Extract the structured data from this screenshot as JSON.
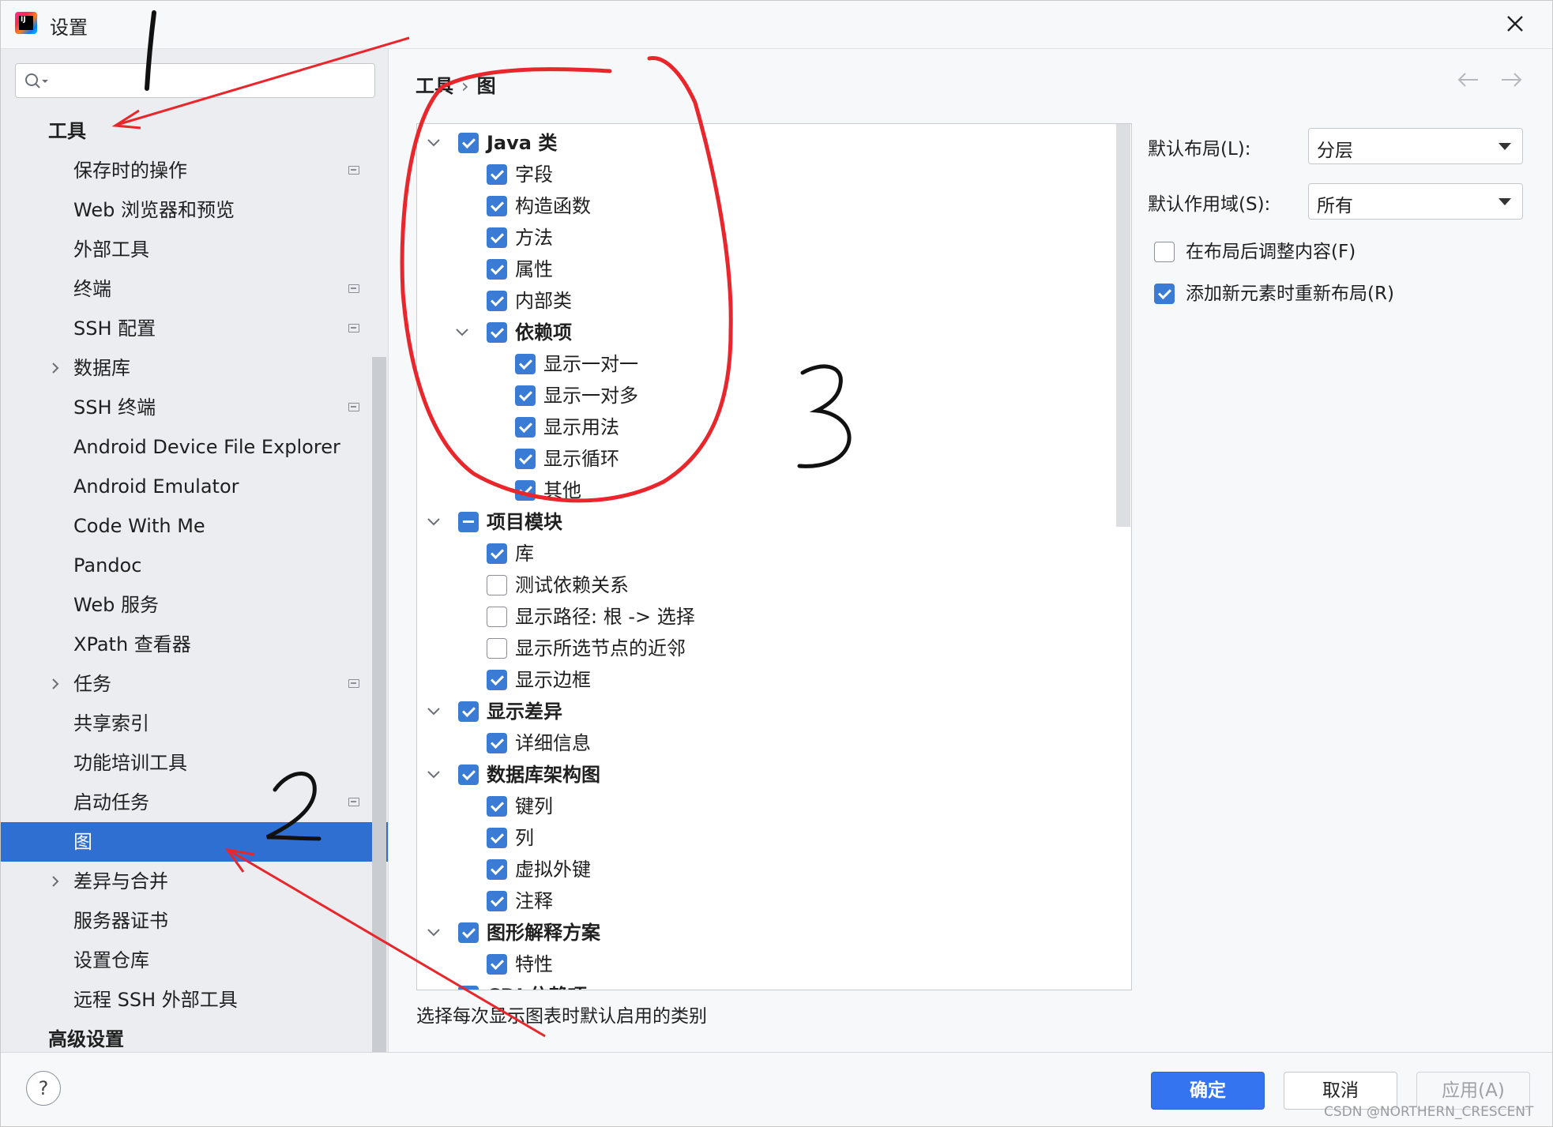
{
  "window": {
    "title": "设置"
  },
  "search": {
    "placeholder": "",
    "value": ""
  },
  "sidebar": {
    "items": [
      {
        "label": "工具",
        "group": true
      },
      {
        "label": "保存时的操作",
        "project": true
      },
      {
        "label": "Web 浏览器和预览"
      },
      {
        "label": "外部工具"
      },
      {
        "label": "终端",
        "project": true
      },
      {
        "label": "SSH 配置",
        "project": true
      },
      {
        "label": "数据库",
        "expandable": true
      },
      {
        "label": "SSH 终端",
        "project": true
      },
      {
        "label": "Android Device File Explorer"
      },
      {
        "label": "Android Emulator"
      },
      {
        "label": "Code With Me"
      },
      {
        "label": "Pandoc"
      },
      {
        "label": "Web 服务"
      },
      {
        "label": "XPath 查看器"
      },
      {
        "label": "任务",
        "expandable": true,
        "project": true
      },
      {
        "label": "共享索引"
      },
      {
        "label": "功能培训工具"
      },
      {
        "label": "启动任务",
        "project": true
      },
      {
        "label": "图",
        "selected": true
      },
      {
        "label": "差异与合并",
        "expandable": true
      },
      {
        "label": "服务器证书"
      },
      {
        "label": "设置仓库"
      },
      {
        "label": "远程 SSH 外部工具"
      },
      {
        "label": "高级设置",
        "group": true
      }
    ]
  },
  "breadcrumb": {
    "parent": "工具",
    "separator": "›",
    "current": "图"
  },
  "categories": [
    {
      "label": "Java 类",
      "level": 0,
      "state": "checked",
      "group": true,
      "expanded": true
    },
    {
      "label": "字段",
      "level": 1,
      "state": "checked"
    },
    {
      "label": "构造函数",
      "level": 1,
      "state": "checked"
    },
    {
      "label": "方法",
      "level": 1,
      "state": "checked"
    },
    {
      "label": "属性",
      "level": 1,
      "state": "checked"
    },
    {
      "label": "内部类",
      "level": 1,
      "state": "checked"
    },
    {
      "label": "依赖项",
      "level": 1,
      "state": "checked",
      "group": true,
      "expanded": true
    },
    {
      "label": "显示一对一",
      "level": 2,
      "state": "checked"
    },
    {
      "label": "显示一对多",
      "level": 2,
      "state": "checked"
    },
    {
      "label": "显示用法",
      "level": 2,
      "state": "checked"
    },
    {
      "label": "显示循环",
      "level": 2,
      "state": "checked"
    },
    {
      "label": "其他",
      "level": 2,
      "state": "checked"
    },
    {
      "label": "项目模块",
      "level": 0,
      "state": "partial",
      "group": true,
      "expanded": true
    },
    {
      "label": "库",
      "level": 1,
      "state": "checked"
    },
    {
      "label": "测试依赖关系",
      "level": 1,
      "state": "unchecked"
    },
    {
      "label": "显示路径: 根 -> 选择",
      "level": 1,
      "state": "unchecked"
    },
    {
      "label": "显示所选节点的近邻",
      "level": 1,
      "state": "unchecked"
    },
    {
      "label": "显示边框",
      "level": 1,
      "state": "checked"
    },
    {
      "label": "显示差异",
      "level": 0,
      "state": "checked",
      "group": true,
      "expanded": true
    },
    {
      "label": "详细信息",
      "level": 1,
      "state": "checked"
    },
    {
      "label": "数据库架构图",
      "level": 0,
      "state": "checked",
      "group": true,
      "expanded": true
    },
    {
      "label": "键列",
      "level": 1,
      "state": "checked"
    },
    {
      "label": "列",
      "level": 1,
      "state": "checked"
    },
    {
      "label": "虚拟外键",
      "level": 1,
      "state": "checked"
    },
    {
      "label": "注释",
      "level": 1,
      "state": "checked"
    },
    {
      "label": "图形解释方案",
      "level": 0,
      "state": "checked",
      "group": true,
      "expanded": true
    },
    {
      "label": "特性",
      "level": 1,
      "state": "checked"
    },
    {
      "label": "CDI 依赖项",
      "level": 0,
      "state": "checked",
      "group": true,
      "expanded": true
    }
  ],
  "description": "选择每次显示图表时默认启用的类别",
  "options": {
    "layout_label": "默认布局(L):",
    "layout_value": "分层",
    "scope_label": "默认作用域(S):",
    "scope_value": "所有",
    "fit_after_layout_label": "在布局后调整内容(F)",
    "fit_after_layout_checked": false,
    "relayout_label": "添加新元素时重新布局(R)",
    "relayout_checked": true
  },
  "buttons": {
    "ok": "确定",
    "cancel": "取消",
    "apply": "应用(A)",
    "help": "?"
  },
  "watermark": "CSDN @NORTHERN_CRESCENT",
  "annotations": {
    "label_1": "1",
    "label_2": "2",
    "label_3": "3"
  },
  "colors": {
    "accent": "#3574f0",
    "selection": "#2f6fd1",
    "annotation_red": "#e8262b"
  }
}
